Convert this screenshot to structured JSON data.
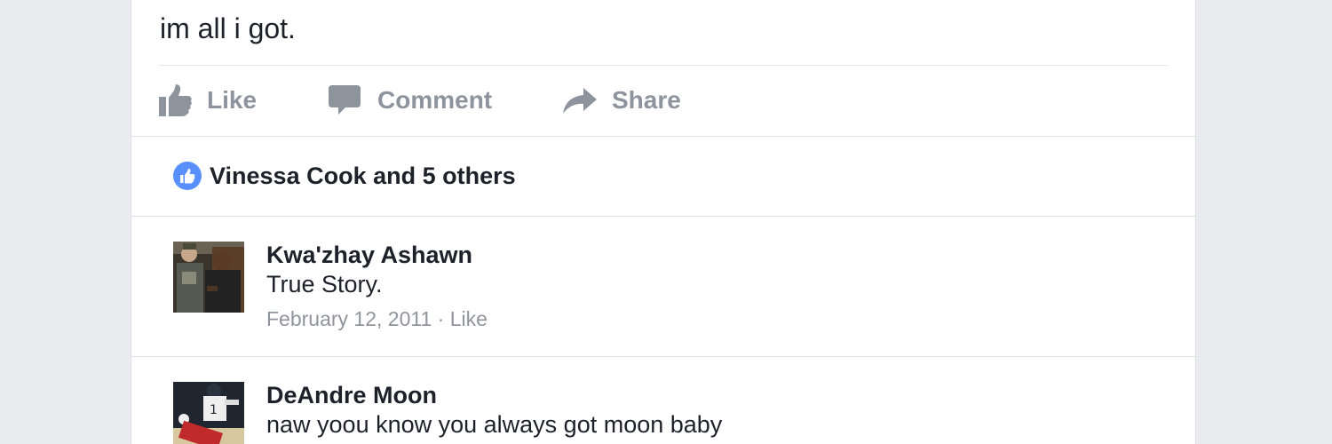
{
  "post": {
    "text": "im all i got."
  },
  "actions": {
    "like": {
      "label": "Like",
      "icon": "thumbs-up-icon"
    },
    "comment": {
      "label": "Comment",
      "icon": "speech-bubble-icon"
    },
    "share": {
      "label": "Share",
      "icon": "share-arrow-icon"
    }
  },
  "reactions": {
    "icon": "like-reaction-icon",
    "text": "Vinessa Cook and 5 others"
  },
  "comments": [
    {
      "author": "Kwa'zhay Ashawn",
      "text": "True Story.",
      "date": "February 12, 2011",
      "separator": "·",
      "like_label": "Like"
    },
    {
      "author": "DeAndre Moon",
      "text": "naw yoou know you always got moon baby"
    }
  ],
  "colors": {
    "page_background": "#e9ebee",
    "card_background": "#ffffff",
    "primary_text": "#1d2129",
    "action_gray": "#8d949e",
    "meta_gray": "#90949c",
    "like_blue": "#5890ff",
    "divider": "#dddfe2"
  }
}
